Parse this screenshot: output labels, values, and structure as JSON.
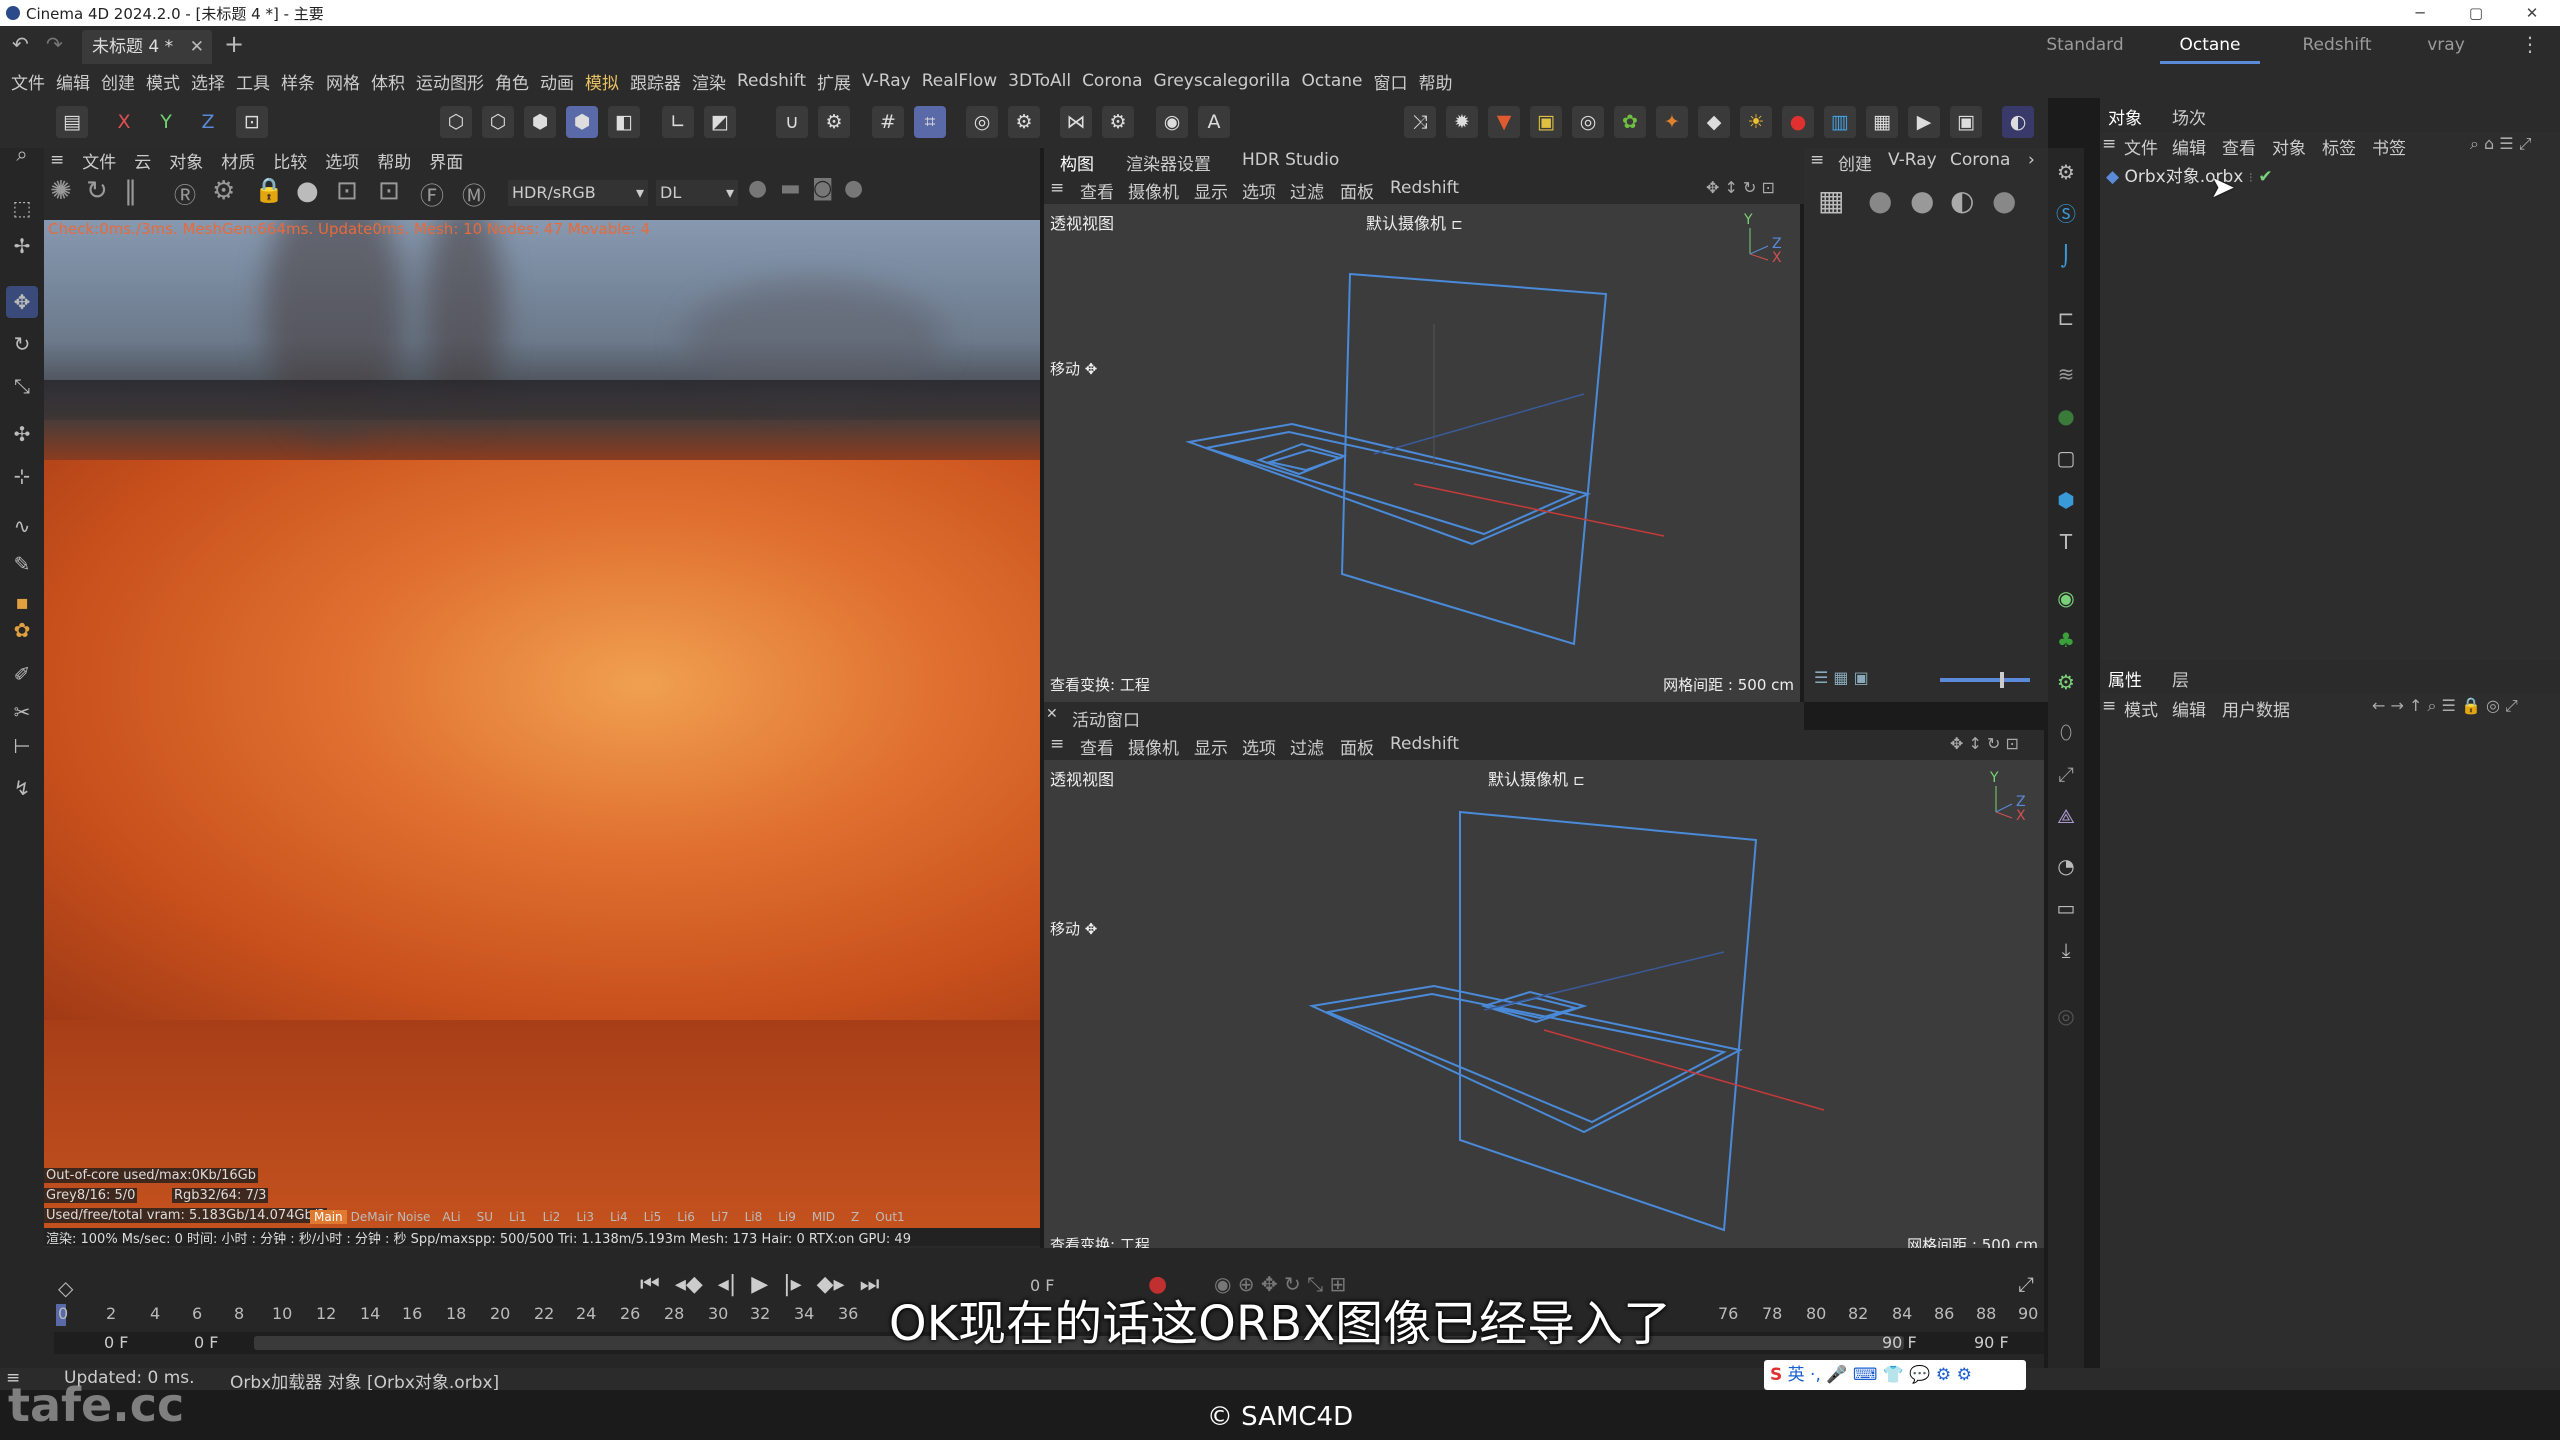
{
  "window": {
    "title": "Cinema 4D 2024.2.0 - [未标题 4 *] - 主要",
    "doc_tab": "未标题 4 *",
    "layouts": [
      "Standard",
      "Octane",
      "Redshift",
      "vray"
    ],
    "active_layout": "Octane"
  },
  "menu": [
    "文件",
    "编辑",
    "创建",
    "模式",
    "选择",
    "工具",
    "样条",
    "网格",
    "体积",
    "运动图形",
    "角色",
    "动画",
    "模拟",
    "跟踪器",
    "渲染",
    "Redshift",
    "扩展",
    "V-Ray",
    "RealFlow",
    "3DToAll",
    "Corona",
    "Greyscalegorilla",
    "Octane",
    "窗口",
    "帮助"
  ],
  "axis_toggles": [
    "X",
    "Y",
    "Z"
  ],
  "ipr": {
    "menu": [
      "文件",
      "云",
      "对象",
      "材质",
      "比较",
      "选项",
      "帮助",
      "界面"
    ],
    "color_space": "HDR/sRGB",
    "mode": "DL",
    "status_line": "Check:0ms./3ms. MeshGen:664ms. Update0ms. Mesh: 10 Nodes: 47 Movable: 4",
    "stats": {
      "ooc": "Out-of-core used/max:0Kb/16Gb",
      "grey": "Grey8/16: 5/0",
      "rgb": "Rgb32/64: 7/3",
      "vram": "Used/free/total vram: 5.183Gb/14.074Gb/2",
      "passes": [
        "Main",
        "DeMair Noise",
        "ALi",
        "SU",
        "Li1",
        "Li2",
        "Li3",
        "Li4",
        "Li5",
        "Li6",
        "Li7",
        "Li8",
        "Li9",
        "MID",
        "Z",
        "Out1"
      ],
      "bottom": "渲染: 100%   Ms/sec: 0   时间: 小时 : 分钟 : 秒/小时 : 分钟 : 秒   Spp/maxspp: 500/500   Tri: 1.138m/5.193m   Mesh: 173  Hair: 0  RTX:on   GPU:   49"
    }
  },
  "viewport_tabs": [
    "构图",
    "渲染器设置",
    "HDR Studio"
  ],
  "viewport_menu": [
    "查看",
    "摄像机",
    "显示",
    "选项",
    "过滤",
    "面板",
    "Redshift"
  ],
  "vp_top": {
    "label": "透视视图",
    "camera": "默认摄像机",
    "move": "移动",
    "transform": "查看变换: 工程",
    "grid": "网格间距 : 500 cm"
  },
  "vp_bottom_title": "活动窗口",
  "vp_bottom": {
    "label": "透视视图",
    "camera": "默认摄像机",
    "move": "移动",
    "transform": "查看变换: 工程",
    "grid": "网格间距 : 500 cm"
  },
  "create_panel": [
    "创建",
    "V-Ray",
    "Corona"
  ],
  "object_manager": {
    "tabs": [
      "对象",
      "场次"
    ],
    "menu": [
      "文件",
      "编辑",
      "查看",
      "对象",
      "标签",
      "书签"
    ],
    "items": [
      {
        "name": "Orbx对象.orbx"
      }
    ]
  },
  "attributes": {
    "tabs": [
      "属性",
      "层"
    ],
    "menu": [
      "模式",
      "编辑",
      "用户数据"
    ]
  },
  "timeline": {
    "ticks": [
      "0",
      "2",
      "4",
      "6",
      "8",
      "10",
      "12",
      "14",
      "16",
      "18",
      "20",
      "22",
      "24",
      "26",
      "28",
      "30",
      "32",
      "34",
      "36",
      "76",
      "78",
      "80",
      "82",
      "84",
      "86",
      "88",
      "90"
    ],
    "start": "0 F",
    "current": "0 F",
    "end": "90 F",
    "end2": "90 F",
    "frame_display": "0 F"
  },
  "status": {
    "left": "Updated: 0 ms.",
    "message": "Orbx加载器 对象 [Orbx对象.orbx]"
  },
  "overlay": {
    "subtitle": "OK现在的话这ORBX图像已经导入了",
    "copyright": "© SAMC4D",
    "watermark": "tafe.cc"
  },
  "ime": "英 ·, 🎤 ⌨ 👕 💬 ⚙ ⚙"
}
